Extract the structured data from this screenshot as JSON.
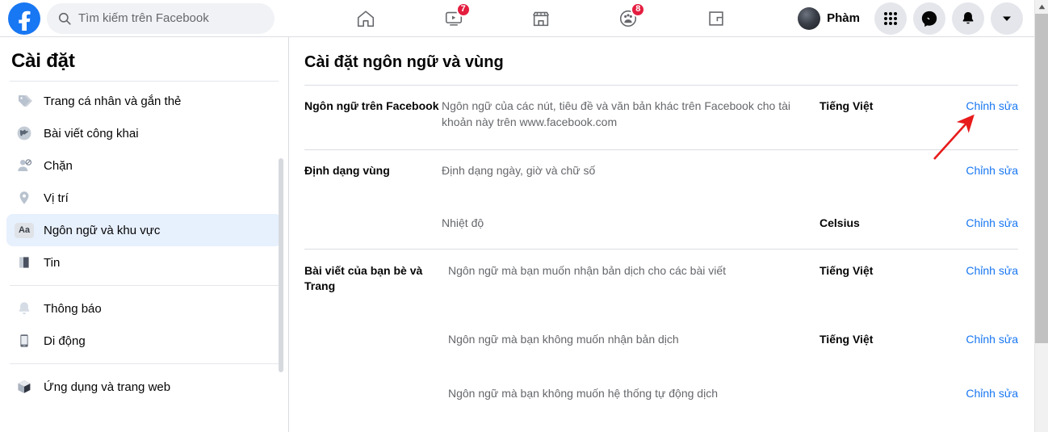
{
  "topbar": {
    "logo_icon": "facebook-logo-icon",
    "search": {
      "icon": "search-icon",
      "placeholder": "Tìm kiếm trên Facebook",
      "value": ""
    },
    "nav": [
      {
        "name": "home",
        "icon": "home-icon",
        "badge": ""
      },
      {
        "name": "watch",
        "icon": "video-watch-icon",
        "badge": "7"
      },
      {
        "name": "marketplace",
        "icon": "marketplace-store-icon",
        "badge": ""
      },
      {
        "name": "groups",
        "icon": "groups-icon",
        "badge": "8"
      },
      {
        "name": "gaming",
        "icon": "gaming-icon",
        "badge": ""
      }
    ],
    "profile_name": "Phàm",
    "avatar_icon": "avatar",
    "actions": [
      {
        "name": "menu",
        "icon": "grid-menu-icon"
      },
      {
        "name": "messenger",
        "icon": "messenger-icon"
      },
      {
        "name": "notifications",
        "icon": "bell-icon"
      },
      {
        "name": "account",
        "icon": "chevron-down-icon"
      }
    ],
    "badge_color": "#e41e3f",
    "brand_color": "#1877f2"
  },
  "sidebar": {
    "title": "Cài đặt",
    "items": [
      {
        "label": "Trang cá nhân và gắn thẻ",
        "icon": "tag-icon",
        "active": false
      },
      {
        "label": "Bài viết công khai",
        "icon": "globe-icon",
        "active": false
      },
      {
        "label": "Chặn",
        "icon": "block-user-icon",
        "active": false
      },
      {
        "label": "Vị trí",
        "icon": "location-pin-icon",
        "active": false
      },
      {
        "label": "Ngôn ngữ và khu vực",
        "icon": "aa-language-icon",
        "active": true
      },
      {
        "label": "Tin",
        "icon": "stories-book-icon",
        "active": false
      },
      {
        "label": "Thông báo",
        "icon": "bell-icon",
        "active": false
      },
      {
        "label": "Di động",
        "icon": "mobile-phone-icon",
        "active": false
      },
      {
        "label": "Ứng dụng và trang web",
        "icon": "cube-apps-icon",
        "active": false
      }
    ],
    "active_bg": "#e7f0fd"
  },
  "main": {
    "title": "Cài đặt ngôn ngữ và vùng",
    "edit_label": "Chỉnh sửa",
    "link_color": "#1877f2",
    "sections": [
      {
        "label": "Ngôn ngữ trên Facebook",
        "rows": [
          {
            "desc": "Ngôn ngữ của các nút, tiêu đề và văn bản khác trên Facebook cho tài khoản này trên www.facebook.com",
            "value": "Tiếng Việt",
            "edit": "Chỉnh sửa"
          }
        ]
      },
      {
        "label": "Định dạng vùng",
        "rows": [
          {
            "desc": "Định dạng ngày, giờ và chữ số",
            "value": "",
            "edit": "Chỉnh sửa"
          },
          {
            "desc": "Nhiệt độ",
            "value": "Celsius",
            "edit": "Chỉnh sửa"
          }
        ]
      },
      {
        "label": "Bài viết của bạn bè và Trang",
        "rows": [
          {
            "desc": "Ngôn ngữ mà bạn muốn nhận bản dịch cho các bài viết",
            "value": "Tiếng Việt",
            "edit": "Chỉnh sửa"
          },
          {
            "desc": "Ngôn ngữ mà bạn không muốn nhận bản dịch",
            "value": "Tiếng Việt",
            "edit": "Chỉnh sửa"
          },
          {
            "desc": "Ngôn ngữ mà bạn không muốn hệ thống tự động dịch",
            "value": "",
            "edit": "Chỉnh sửa"
          }
        ]
      }
    ]
  },
  "annotation": {
    "arrow_color": "#e81b1b",
    "points_to": "Chỉnh sửa"
  }
}
